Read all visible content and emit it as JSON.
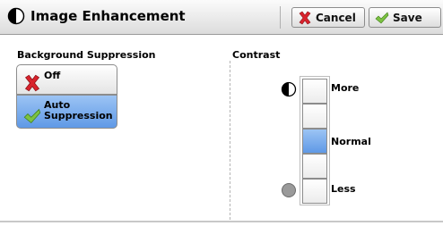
{
  "header": {
    "title": "Image Enhancement",
    "title_icon": "half-circle-icon",
    "cancel_label": "Cancel",
    "cancel_icon": "x-icon",
    "save_label": "Save",
    "save_icon": "checkmark-icon"
  },
  "background_suppression": {
    "label": "Background Suppression",
    "options": [
      {
        "label": "Off",
        "icon": "x-icon",
        "selected": false
      },
      {
        "label_line1": "Auto",
        "label_line2": "Suppression",
        "icon": "checkmark-icon",
        "selected": true
      }
    ]
  },
  "contrast": {
    "label": "Contrast",
    "more_label": "More",
    "normal_label": "Normal",
    "less_label": "Less",
    "levels": 5,
    "selected_level": 3,
    "top_icon": "half-circle-icon",
    "bottom_icon": "grey-circle-icon"
  },
  "colors": {
    "selected": "#6fa4ea",
    "cancel_x": "#d9232d",
    "check": "#7cc242"
  }
}
